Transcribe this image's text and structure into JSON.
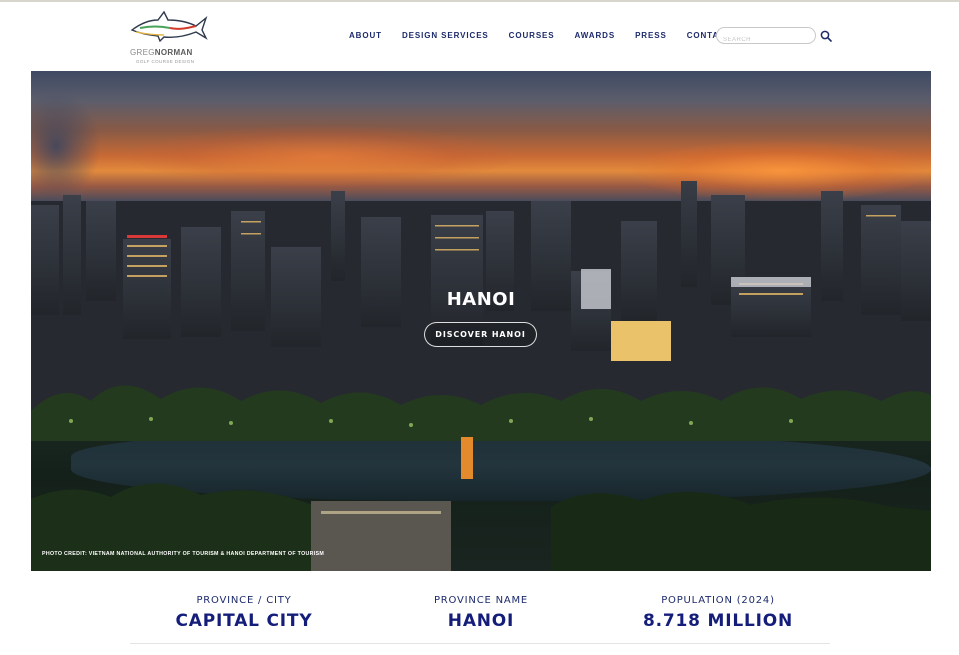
{
  "brand": {
    "name_light": "GREG",
    "name_bold": "NORMAN",
    "tagline": "GOLF COURSE DESIGN",
    "colors": {
      "shark_outline": "#2f3a4e",
      "shark_red": "#d23b2b",
      "shark_green": "#4aa35a",
      "accent": "#141e7a"
    }
  },
  "nav": {
    "items": [
      {
        "label": "ABOUT"
      },
      {
        "label": "DESIGN SERVICES"
      },
      {
        "label": "COURSES"
      },
      {
        "label": "AWARDS"
      },
      {
        "label": "PRESS"
      },
      {
        "label": "CONTACT"
      }
    ]
  },
  "search": {
    "placeholder": "SEARCH",
    "value": "",
    "icon": "magnifier-icon"
  },
  "hero": {
    "title": "HANOI",
    "button_label": "DISCOVER HANOI",
    "photo_credit": "PHOTO CREDIT: VIETNAM NATIONAL AUTHORITY OF TOURISM & HANOI DEPARTMENT OF TOURISM"
  },
  "stats": [
    {
      "label": "PROVINCE / CITY",
      "value": "CAPITAL CITY"
    },
    {
      "label": "PROVINCE NAME",
      "value": "HANOI"
    },
    {
      "label": "POPULATION (2024)",
      "value": "8.718 MILLION"
    }
  ]
}
